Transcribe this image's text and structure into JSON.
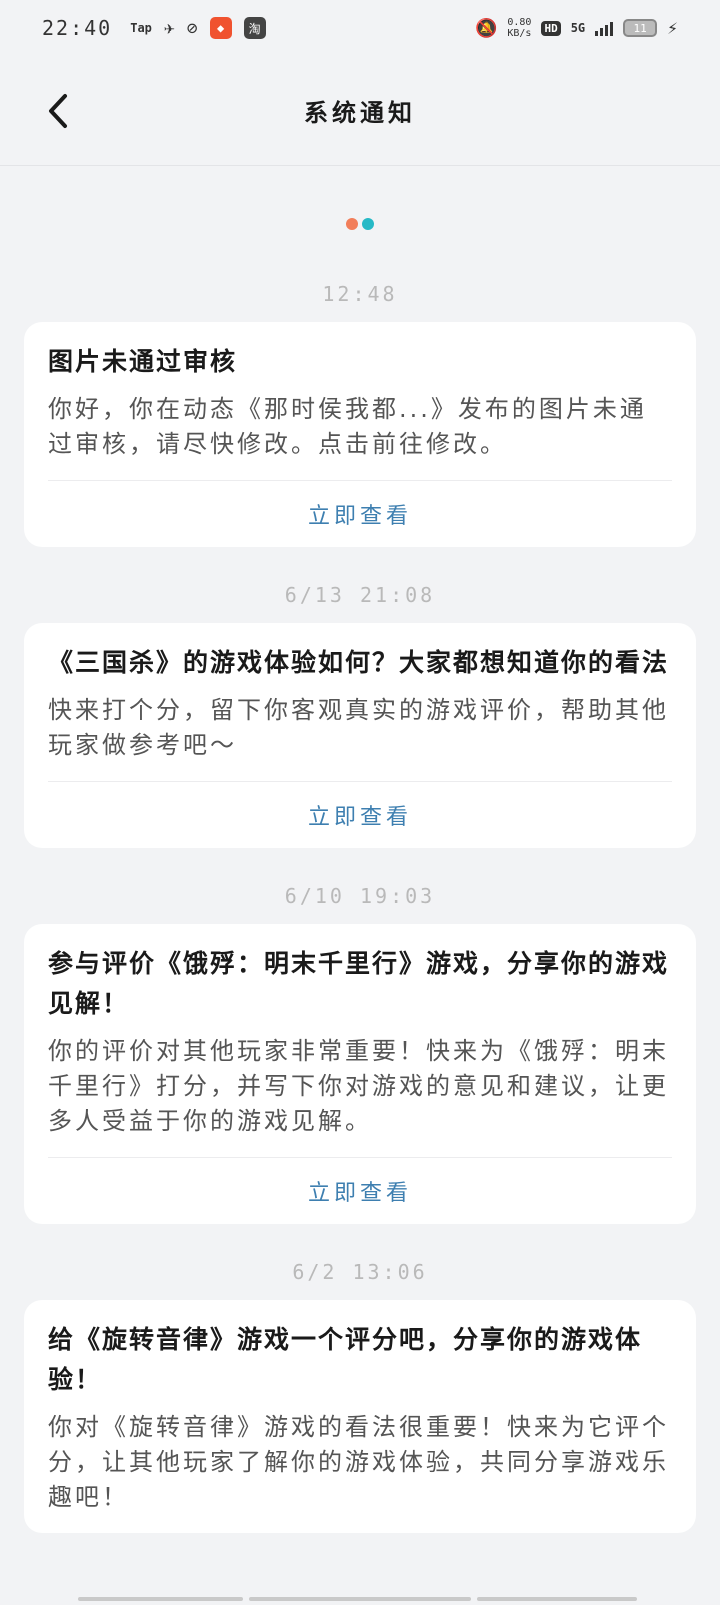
{
  "status_bar": {
    "time": "22:40",
    "tap_label": "Tap",
    "taobao_label": "淘",
    "speed": "0.80",
    "speed_unit": "KB/s",
    "hd": "HD",
    "network": "5G",
    "battery": "11"
  },
  "header": {
    "title": "系统通知"
  },
  "loading": {
    "dot_colors": [
      "#f27e5a",
      "#26b9c6"
    ]
  },
  "notifications": [
    {
      "time": "12:48",
      "title": "图片未通过审核",
      "body": "你好，你在动态《那时侯我都...》发布的图片未通过审核，请尽快修改。点击前往修改。",
      "action": "立即查看"
    },
    {
      "time": "6/13 21:08",
      "title": "《三国杀》的游戏体验如何？大家都想知道你的看法",
      "body": "快来打个分，留下你客观真实的游戏评价，帮助其他玩家做参考吧～",
      "action": "立即查看"
    },
    {
      "time": "6/10 19:03",
      "title": "参与评价《饿殍：明末千里行》游戏，分享你的游戏见解！",
      "body": "你的评价对其他玩家非常重要！快来为《饿殍：明末千里行》打分，并写下你对游戏的意见和建议，让更多人受益于你的游戏见解。",
      "action": "立即查看"
    },
    {
      "time": "6/2 13:06",
      "title": "给《旋转音律》游戏一个评分吧，分享你的游戏体验！",
      "body": "你对《旋转音律》游戏的看法很重要！快来为它评个分，让其他玩家了解你的游戏体验，共同分享游戏乐趣吧！",
      "action": ""
    }
  ]
}
